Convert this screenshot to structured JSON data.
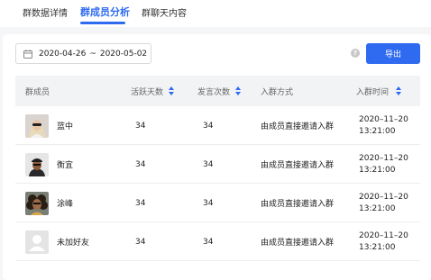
{
  "tabs": [
    {
      "label": "群数据详情",
      "active": false
    },
    {
      "label": "群成员分析",
      "active": true
    },
    {
      "label": "群聊天内容",
      "active": false
    }
  ],
  "filters": {
    "date_start": "2020-04-26",
    "date_separator": "~",
    "date_end": "2020-05-02",
    "calendar_icon": "calendar-icon"
  },
  "toolbar": {
    "help_icon": "question-icon",
    "help_glyph": "?",
    "export_label": "导出"
  },
  "accent_color": "#2f6bf0",
  "table": {
    "columns": [
      "群成员",
      "活跃天数",
      "发言次数",
      "入群方式",
      "入群时间"
    ],
    "rows": [
      {
        "name": "蓝中",
        "active_days": "34",
        "messages": "34",
        "join_method": "由成员直接邀请入群",
        "join_date": "2020–11–20",
        "join_time": "13:21:00",
        "avatar": "woman-with-sunglasses"
      },
      {
        "name": "衡宜",
        "active_days": "34",
        "messages": "34",
        "join_method": "由成员直接邀请入群",
        "join_date": "2020–11–20",
        "join_time": "13:21:00",
        "avatar": "man-with-cap"
      },
      {
        "name": "涂峰",
        "active_days": "34",
        "messages": "34",
        "join_method": "由成员直接邀请入群",
        "join_date": "2020–11–20",
        "join_time": "13:21:00",
        "avatar": "man-curly-hair"
      },
      {
        "name": "未加好友",
        "active_days": "34",
        "messages": "34",
        "join_method": "由成员直接邀请入群",
        "join_date": "2020–11–20",
        "join_time": "13:21:00",
        "avatar": "default-avatar"
      }
    ]
  }
}
